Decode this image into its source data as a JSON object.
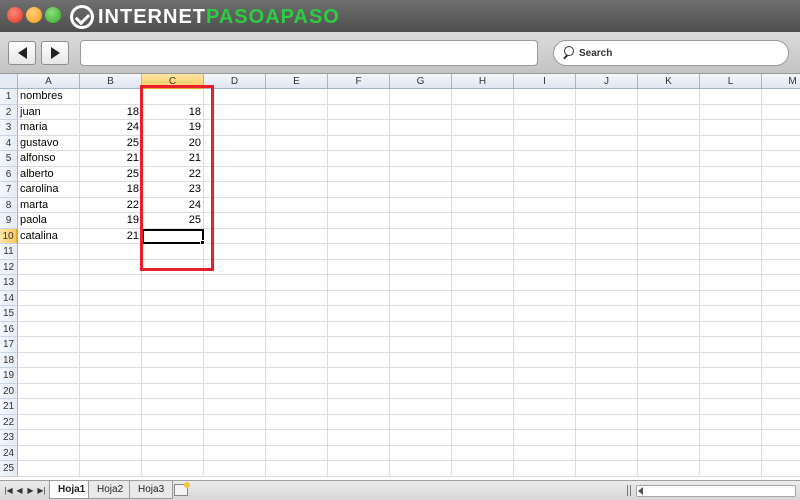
{
  "window": {
    "logo_part1": "INTERNET",
    "logo_part2": "PASOAPASO",
    "search_label": "Search"
  },
  "icons": {
    "close": "close-icon",
    "minimize": "minimize-icon",
    "maximize": "maximize-icon",
    "back": "back-arrow-icon",
    "forward": "forward-arrow-icon",
    "search": "search-icon",
    "new_sheet": "new-sheet-icon"
  },
  "colors": {
    "highlight_box": "#e8202a",
    "active_header": "#f8cb5f",
    "logo_green": "#2ecc40"
  },
  "spreadsheet": {
    "columns": [
      "A",
      "B",
      "C",
      "D",
      "E",
      "F",
      "G",
      "H",
      "I",
      "J",
      "K",
      "L",
      "M"
    ],
    "active_column": "C",
    "active_row": 10,
    "selected_cell": "C10",
    "row_numbers": [
      "1",
      "2",
      "3",
      "4",
      "5",
      "6",
      "7",
      "8",
      "9",
      "10",
      "11",
      "12",
      "13",
      "14",
      "15",
      "16",
      "17",
      "18",
      "19",
      "20",
      "21",
      "22",
      "23",
      "24",
      "25"
    ],
    "column_A": [
      "nombres",
      "juan",
      "maria",
      "gustavo",
      "alfonso",
      "alberto",
      "carolina",
      "marta",
      "paola",
      "catalina"
    ],
    "column_B": [
      "",
      "18",
      "24",
      "25",
      "21",
      "25",
      "18",
      "22",
      "19",
      "21"
    ],
    "column_C": [
      "",
      "18",
      "19",
      "20",
      "21",
      "22",
      "23",
      "24",
      "25",
      ""
    ]
  },
  "sheet_tabs": [
    "Hoja1",
    "Hoja2",
    "Hoja3"
  ],
  "active_tab": "Hoja1"
}
